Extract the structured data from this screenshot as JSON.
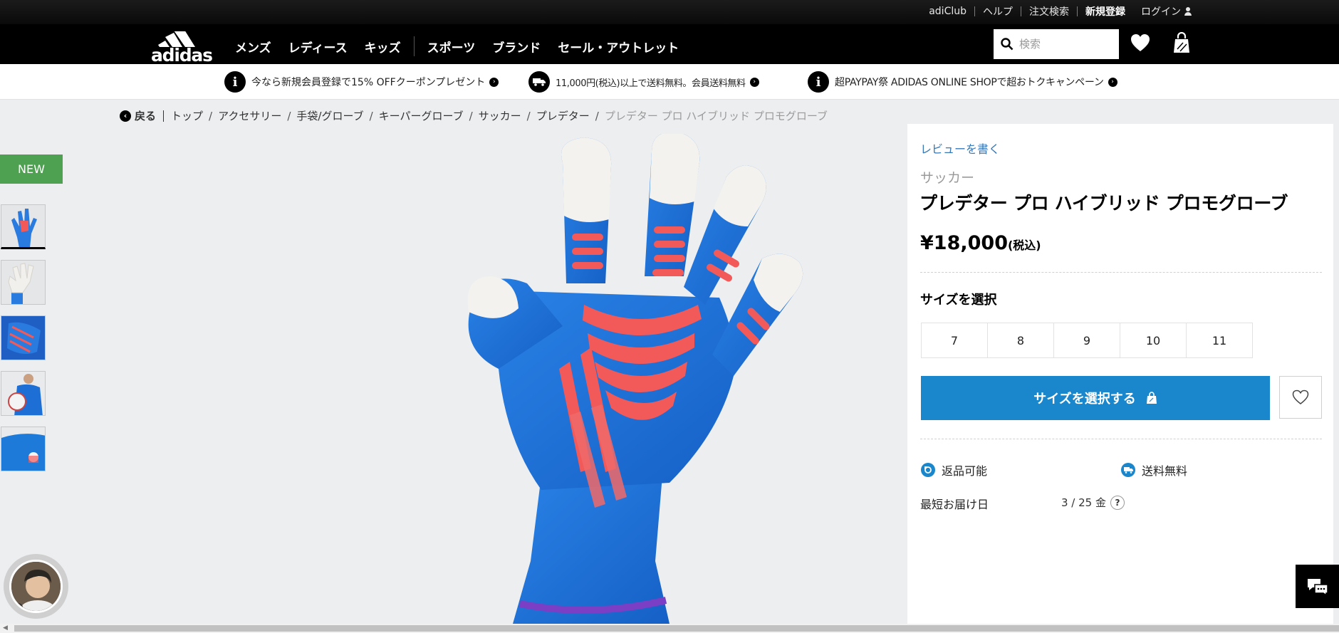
{
  "utility_nav": {
    "items": [
      "adiClub",
      "ヘルプ",
      "注文検索",
      "新規登録",
      "ログイン"
    ]
  },
  "brand": {
    "name": "adidas"
  },
  "main_nav": {
    "items": [
      "メンズ",
      "レディース",
      "キッズ"
    ],
    "items2": [
      "スポーツ",
      "ブランド",
      "セール・アウトレット"
    ]
  },
  "search": {
    "placeholder": "検索"
  },
  "promos": [
    {
      "text": "今なら新規会員登録で15% OFFクーポンプレゼント",
      "icon": "info-icon"
    },
    {
      "text": "11,000円(税込)以上で送料無料。会員送料無料",
      "icon": "truck-icon"
    },
    {
      "text": "超PAYPAY祭 ADIDAS ONLINE SHOPで超おトクキャンペーン",
      "icon": "info-icon"
    }
  ],
  "breadcrumb": {
    "back": "戻る",
    "items": [
      "トップ",
      "アクセサリー",
      "手袋/グローブ",
      "キーパーグローブ",
      "サッカー",
      "プレデター"
    ],
    "current": "プレデター プロ ハイブリッド プロモグローブ"
  },
  "gallery": {
    "badge": "NEW",
    "thumbnail_count": 5
  },
  "product": {
    "review_link": "レビューを書く",
    "category": "サッカー",
    "title": "プレデター プロ ハイブリッド プロモグローブ",
    "price": "¥18,000",
    "tax_note": "(税込)",
    "size_label": "サイズを選択",
    "sizes": [
      "7",
      "8",
      "9",
      "10",
      "11"
    ],
    "cta_label": "サイズを選択する",
    "features": [
      "返品可能",
      "送料無料"
    ],
    "delivery_label": "最短お届け日",
    "delivery_date": "3 / 25 金",
    "help": "?"
  },
  "colors": {
    "cta": "#1a86cc",
    "new_badge": "#4da150",
    "link": "#3778b5",
    "glove_blue": "#1f72d6",
    "glove_red": "#f25a5a"
  }
}
